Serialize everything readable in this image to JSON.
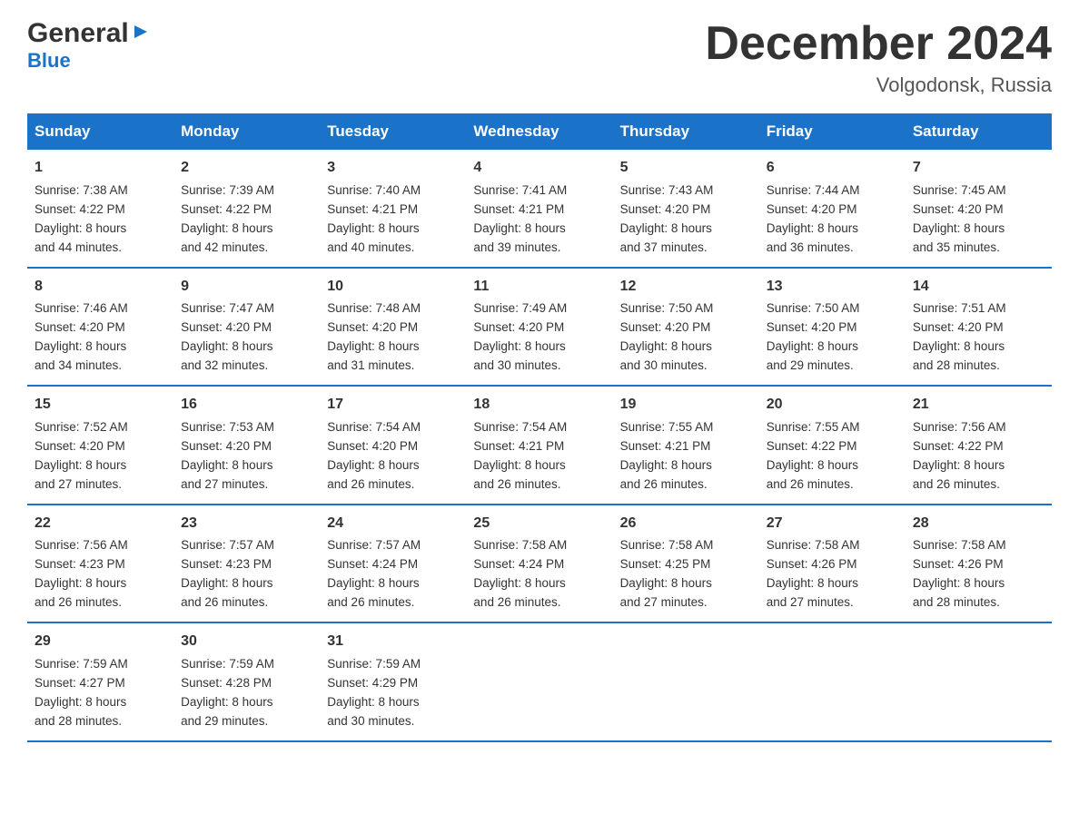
{
  "header": {
    "logo_general": "General",
    "logo_blue": "Blue",
    "title": "December 2024",
    "subtitle": "Volgodonsk, Russia"
  },
  "days_of_week": [
    "Sunday",
    "Monday",
    "Tuesday",
    "Wednesday",
    "Thursday",
    "Friday",
    "Saturday"
  ],
  "weeks": [
    [
      {
        "day": "1",
        "sunrise": "Sunrise: 7:38 AM",
        "sunset": "Sunset: 4:22 PM",
        "daylight": "Daylight: 8 hours",
        "daylight2": "and 44 minutes."
      },
      {
        "day": "2",
        "sunrise": "Sunrise: 7:39 AM",
        "sunset": "Sunset: 4:22 PM",
        "daylight": "Daylight: 8 hours",
        "daylight2": "and 42 minutes."
      },
      {
        "day": "3",
        "sunrise": "Sunrise: 7:40 AM",
        "sunset": "Sunset: 4:21 PM",
        "daylight": "Daylight: 8 hours",
        "daylight2": "and 40 minutes."
      },
      {
        "day": "4",
        "sunrise": "Sunrise: 7:41 AM",
        "sunset": "Sunset: 4:21 PM",
        "daylight": "Daylight: 8 hours",
        "daylight2": "and 39 minutes."
      },
      {
        "day": "5",
        "sunrise": "Sunrise: 7:43 AM",
        "sunset": "Sunset: 4:20 PM",
        "daylight": "Daylight: 8 hours",
        "daylight2": "and 37 minutes."
      },
      {
        "day": "6",
        "sunrise": "Sunrise: 7:44 AM",
        "sunset": "Sunset: 4:20 PM",
        "daylight": "Daylight: 8 hours",
        "daylight2": "and 36 minutes."
      },
      {
        "day": "7",
        "sunrise": "Sunrise: 7:45 AM",
        "sunset": "Sunset: 4:20 PM",
        "daylight": "Daylight: 8 hours",
        "daylight2": "and 35 minutes."
      }
    ],
    [
      {
        "day": "8",
        "sunrise": "Sunrise: 7:46 AM",
        "sunset": "Sunset: 4:20 PM",
        "daylight": "Daylight: 8 hours",
        "daylight2": "and 34 minutes."
      },
      {
        "day": "9",
        "sunrise": "Sunrise: 7:47 AM",
        "sunset": "Sunset: 4:20 PM",
        "daylight": "Daylight: 8 hours",
        "daylight2": "and 32 minutes."
      },
      {
        "day": "10",
        "sunrise": "Sunrise: 7:48 AM",
        "sunset": "Sunset: 4:20 PM",
        "daylight": "Daylight: 8 hours",
        "daylight2": "and 31 minutes."
      },
      {
        "day": "11",
        "sunrise": "Sunrise: 7:49 AM",
        "sunset": "Sunset: 4:20 PM",
        "daylight": "Daylight: 8 hours",
        "daylight2": "and 30 minutes."
      },
      {
        "day": "12",
        "sunrise": "Sunrise: 7:50 AM",
        "sunset": "Sunset: 4:20 PM",
        "daylight": "Daylight: 8 hours",
        "daylight2": "and 30 minutes."
      },
      {
        "day": "13",
        "sunrise": "Sunrise: 7:50 AM",
        "sunset": "Sunset: 4:20 PM",
        "daylight": "Daylight: 8 hours",
        "daylight2": "and 29 minutes."
      },
      {
        "day": "14",
        "sunrise": "Sunrise: 7:51 AM",
        "sunset": "Sunset: 4:20 PM",
        "daylight": "Daylight: 8 hours",
        "daylight2": "and 28 minutes."
      }
    ],
    [
      {
        "day": "15",
        "sunrise": "Sunrise: 7:52 AM",
        "sunset": "Sunset: 4:20 PM",
        "daylight": "Daylight: 8 hours",
        "daylight2": "and 27 minutes."
      },
      {
        "day": "16",
        "sunrise": "Sunrise: 7:53 AM",
        "sunset": "Sunset: 4:20 PM",
        "daylight": "Daylight: 8 hours",
        "daylight2": "and 27 minutes."
      },
      {
        "day": "17",
        "sunrise": "Sunrise: 7:54 AM",
        "sunset": "Sunset: 4:20 PM",
        "daylight": "Daylight: 8 hours",
        "daylight2": "and 26 minutes."
      },
      {
        "day": "18",
        "sunrise": "Sunrise: 7:54 AM",
        "sunset": "Sunset: 4:21 PM",
        "daylight": "Daylight: 8 hours",
        "daylight2": "and 26 minutes."
      },
      {
        "day": "19",
        "sunrise": "Sunrise: 7:55 AM",
        "sunset": "Sunset: 4:21 PM",
        "daylight": "Daylight: 8 hours",
        "daylight2": "and 26 minutes."
      },
      {
        "day": "20",
        "sunrise": "Sunrise: 7:55 AM",
        "sunset": "Sunset: 4:22 PM",
        "daylight": "Daylight: 8 hours",
        "daylight2": "and 26 minutes."
      },
      {
        "day": "21",
        "sunrise": "Sunrise: 7:56 AM",
        "sunset": "Sunset: 4:22 PM",
        "daylight": "Daylight: 8 hours",
        "daylight2": "and 26 minutes."
      }
    ],
    [
      {
        "day": "22",
        "sunrise": "Sunrise: 7:56 AM",
        "sunset": "Sunset: 4:23 PM",
        "daylight": "Daylight: 8 hours",
        "daylight2": "and 26 minutes."
      },
      {
        "day": "23",
        "sunrise": "Sunrise: 7:57 AM",
        "sunset": "Sunset: 4:23 PM",
        "daylight": "Daylight: 8 hours",
        "daylight2": "and 26 minutes."
      },
      {
        "day": "24",
        "sunrise": "Sunrise: 7:57 AM",
        "sunset": "Sunset: 4:24 PM",
        "daylight": "Daylight: 8 hours",
        "daylight2": "and 26 minutes."
      },
      {
        "day": "25",
        "sunrise": "Sunrise: 7:58 AM",
        "sunset": "Sunset: 4:24 PM",
        "daylight": "Daylight: 8 hours",
        "daylight2": "and 26 minutes."
      },
      {
        "day": "26",
        "sunrise": "Sunrise: 7:58 AM",
        "sunset": "Sunset: 4:25 PM",
        "daylight": "Daylight: 8 hours",
        "daylight2": "and 27 minutes."
      },
      {
        "day": "27",
        "sunrise": "Sunrise: 7:58 AM",
        "sunset": "Sunset: 4:26 PM",
        "daylight": "Daylight: 8 hours",
        "daylight2": "and 27 minutes."
      },
      {
        "day": "28",
        "sunrise": "Sunrise: 7:58 AM",
        "sunset": "Sunset: 4:26 PM",
        "daylight": "Daylight: 8 hours",
        "daylight2": "and 28 minutes."
      }
    ],
    [
      {
        "day": "29",
        "sunrise": "Sunrise: 7:59 AM",
        "sunset": "Sunset: 4:27 PM",
        "daylight": "Daylight: 8 hours",
        "daylight2": "and 28 minutes."
      },
      {
        "day": "30",
        "sunrise": "Sunrise: 7:59 AM",
        "sunset": "Sunset: 4:28 PM",
        "daylight": "Daylight: 8 hours",
        "daylight2": "and 29 minutes."
      },
      {
        "day": "31",
        "sunrise": "Sunrise: 7:59 AM",
        "sunset": "Sunset: 4:29 PM",
        "daylight": "Daylight: 8 hours",
        "daylight2": "and 30 minutes."
      },
      {
        "day": "",
        "sunrise": "",
        "sunset": "",
        "daylight": "",
        "daylight2": ""
      },
      {
        "day": "",
        "sunrise": "",
        "sunset": "",
        "daylight": "",
        "daylight2": ""
      },
      {
        "day": "",
        "sunrise": "",
        "sunset": "",
        "daylight": "",
        "daylight2": ""
      },
      {
        "day": "",
        "sunrise": "",
        "sunset": "",
        "daylight": "",
        "daylight2": ""
      }
    ]
  ]
}
